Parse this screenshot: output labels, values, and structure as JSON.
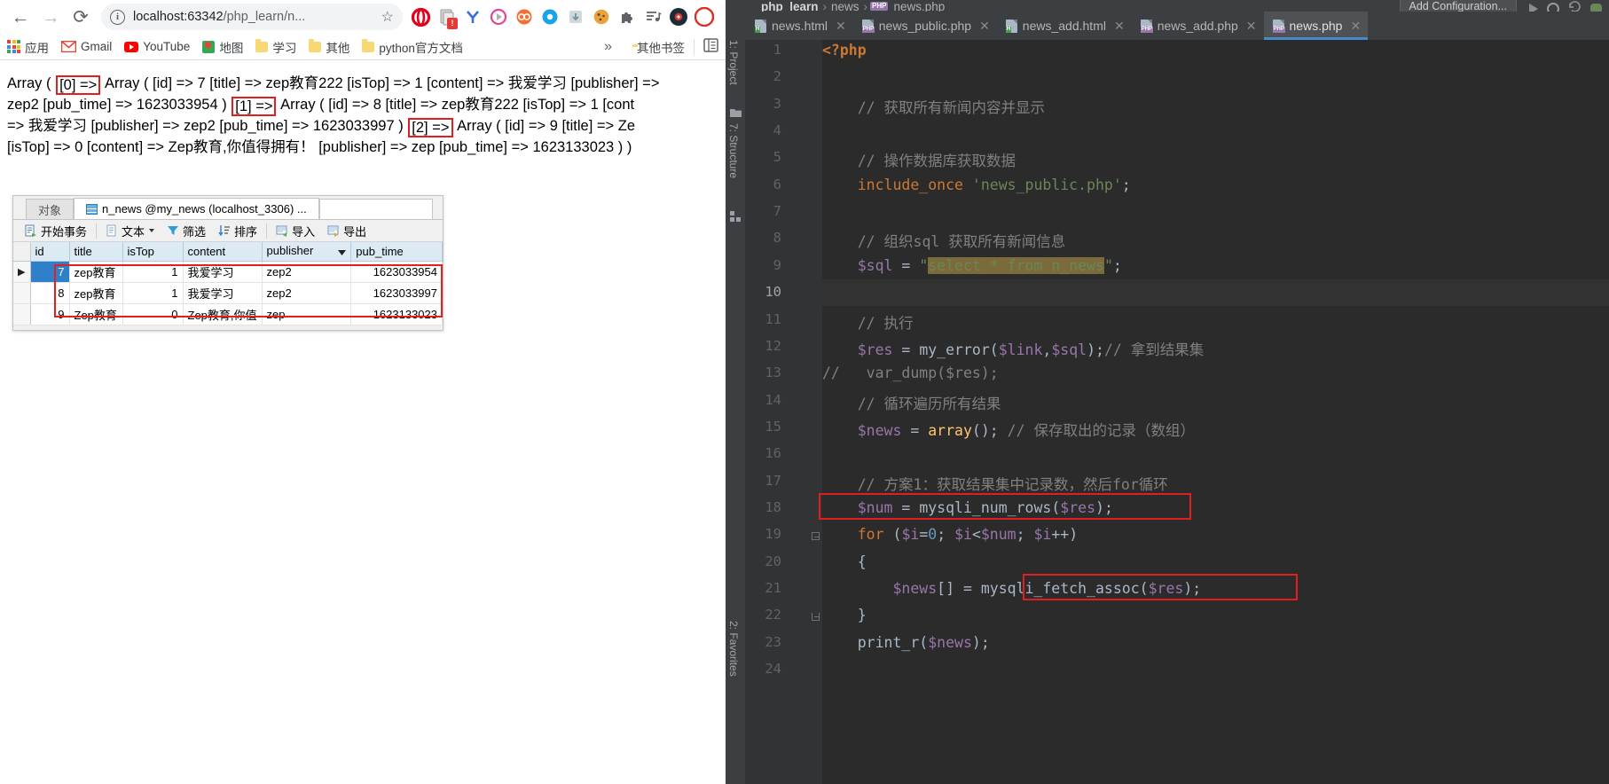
{
  "browser": {
    "nav": {
      "back": "←",
      "forward": "→",
      "reload": "⟳"
    },
    "omnibox": {
      "site_info_icon": "info-icon",
      "url_host": "localhost:63342",
      "url_path": "/php_learn/n...",
      "star_icon": "☆"
    },
    "bookmarks": [
      {
        "label": "应用",
        "icon": "apps-grid-icon"
      },
      {
        "label": "Gmail",
        "icon": "gmail-icon"
      },
      {
        "label": "YouTube",
        "icon": "youtube-icon"
      },
      {
        "label": "地图",
        "icon": "maps-icon"
      },
      {
        "label": "学习",
        "icon": "folder-icon"
      },
      {
        "label": "其他",
        "icon": "folder-icon"
      },
      {
        "label": "python官方文档",
        "icon": "folder-icon"
      }
    ],
    "bookmarks_overflow": "»",
    "bookmarks_right": {
      "label": "其他书签",
      "icon": "folder-icon",
      "reading_list_icon": "reading-list-icon"
    },
    "page_output": {
      "line1_a": "Array ( ",
      "line1_hl": "[0] =>",
      "line1_b": " Array ( [id] => 7 [title] => zep教育222 [isTop] => 1 [content] => 我爱学习 [publisher] =>",
      "line2_a": "zep2 [pub_time] => 1623033954 ) ",
      "line2_hl": "[1] =>",
      "line2_b": " Array ( [id] => 8 [title] => zep教育222 [isTop] => 1 [cont",
      "line3_a": "=> 我爱学习 [publisher] => zep2 [pub_time] => 1623033997 ) ",
      "line3_hl": "[2] =>",
      "line3_b": " Array ( [id] => 9 [title] => Ze",
      "line4": "[isTop] => 0 [content] => Zep教育,你值得拥有！ [publisher] => zep [pub_time] => 1623133023 ) )"
    }
  },
  "navicat": {
    "tabs": [
      {
        "label": "对象",
        "active": false
      },
      {
        "label": "n_news @my_news (localhost_3306) ...",
        "active": true
      }
    ],
    "toolbar": [
      {
        "label": "开始事务",
        "icon": "transaction-icon"
      },
      {
        "label": "文本",
        "icon": "text-icon",
        "caret": true
      },
      {
        "label": "筛选",
        "icon": "filter-icon"
      },
      {
        "label": "排序",
        "icon": "sort-icon"
      },
      {
        "label": "导入",
        "icon": "import-icon"
      },
      {
        "label": "导出",
        "icon": "export-icon"
      }
    ],
    "grid": {
      "columns": [
        "id",
        "title",
        "isTop",
        "content",
        "publisher",
        "pub_time"
      ],
      "sorted_column": "publisher",
      "rows": [
        {
          "marker": "▶",
          "id": "7",
          "title": "zep教育",
          "isTop": "1",
          "content": "我爱学习",
          "publisher": "zep2",
          "pub_time": "1623033954",
          "selected": true
        },
        {
          "marker": "",
          "id": "8",
          "title": "zep教育",
          "isTop": "1",
          "content": "我爱学习",
          "publisher": "zep2",
          "pub_time": "1623033997",
          "selected": false
        },
        {
          "marker": "",
          "id": "9",
          "title": "Zep教育",
          "isTop": "0",
          "content": "Zep教育,你值",
          "publisher": "zep",
          "pub_time": "1623133023",
          "selected": false
        }
      ]
    }
  },
  "ide": {
    "breadcrumb": {
      "project": "php_learn",
      "folder": "news",
      "file": "news.php",
      "sep": "›",
      "file_tag": "PHP"
    },
    "add_configuration": "Add Configuration...",
    "tabs": [
      {
        "label": "news.html",
        "type": "html",
        "active": false
      },
      {
        "label": "news_public.php",
        "type": "php",
        "active": false
      },
      {
        "label": "news_add.html",
        "type": "html",
        "active": false
      },
      {
        "label": "news_add.php",
        "type": "php",
        "active": false
      },
      {
        "label": "news.php",
        "type": "php",
        "active": true
      }
    ],
    "tab_close": "✕",
    "side_strips": [
      {
        "label": "1: Project"
      },
      {
        "label": "7: Structure"
      },
      {
        "label": "2: Favorites"
      }
    ],
    "line_numbers": [
      "1",
      "2",
      "3",
      "4",
      "5",
      "6",
      "7",
      "8",
      "9",
      "10",
      "11",
      "12",
      "13",
      "14",
      "15",
      "16",
      "17",
      "18",
      "19",
      "20",
      "21",
      "22",
      "23",
      "24"
    ],
    "current_line": "10",
    "code": [
      {
        "n": "1",
        "segs": [
          {
            "t": "<?php",
            "c": "kk"
          }
        ]
      },
      {
        "n": "2",
        "segs": []
      },
      {
        "n": "3",
        "segs": [
          {
            "t": "    // 获取所有新闻内容并显示",
            "c": "c"
          }
        ]
      },
      {
        "n": "4",
        "segs": []
      },
      {
        "n": "5",
        "segs": [
          {
            "t": "    // 操作数据库获取数据",
            "c": "c"
          }
        ]
      },
      {
        "n": "6",
        "segs": [
          {
            "t": "    ",
            "c": "p"
          },
          {
            "t": "include_once",
            "c": "k"
          },
          {
            "t": " ",
            "c": "p"
          },
          {
            "t": "'news_public.php'",
            "c": "s"
          },
          {
            "t": ";",
            "c": "p"
          }
        ]
      },
      {
        "n": "7",
        "segs": []
      },
      {
        "n": "8",
        "segs": [
          {
            "t": "    // 组织sql 获取所有新闻信息",
            "c": "c"
          }
        ]
      },
      {
        "n": "9",
        "segs": [
          {
            "t": "    ",
            "c": "p"
          },
          {
            "t": "$sql",
            "c": "v"
          },
          {
            "t": " = ",
            "c": "p"
          },
          {
            "t": "\"",
            "c": "s"
          },
          {
            "t": "select * from n_news",
            "c": "s hl-find"
          },
          {
            "t": "\"",
            "c": "s"
          },
          {
            "t": ";",
            "c": "p"
          }
        ]
      },
      {
        "n": "10",
        "segs": []
      },
      {
        "n": "11",
        "segs": [
          {
            "t": "    // 执行",
            "c": "c"
          }
        ]
      },
      {
        "n": "12",
        "segs": [
          {
            "t": "    ",
            "c": "p"
          },
          {
            "t": "$res",
            "c": "v"
          },
          {
            "t": " = ",
            "c": "p"
          },
          {
            "t": "my_error",
            "c": "p"
          },
          {
            "t": "(",
            "c": "p"
          },
          {
            "t": "$link",
            "c": "v"
          },
          {
            "t": ",",
            "c": "p"
          },
          {
            "t": "$sql",
            "c": "v"
          },
          {
            "t": ");",
            "c": "p"
          },
          {
            "t": "// 拿到结果集",
            "c": "c"
          }
        ]
      },
      {
        "n": "13",
        "segs": [
          {
            "t": "//   var_dump($res);",
            "c": "c"
          }
        ]
      },
      {
        "n": "14",
        "segs": [
          {
            "t": "    // 循环遍历所有结果",
            "c": "c"
          }
        ]
      },
      {
        "n": "15",
        "segs": [
          {
            "t": "    ",
            "c": "p"
          },
          {
            "t": "$news",
            "c": "v"
          },
          {
            "t": " = ",
            "c": "p"
          },
          {
            "t": "array",
            "c": "f"
          },
          {
            "t": "(); ",
            "c": "p"
          },
          {
            "t": "// 保存取出的记录（数组）",
            "c": "c"
          }
        ]
      },
      {
        "n": "16",
        "segs": []
      },
      {
        "n": "17",
        "segs": [
          {
            "t": "    // 方案1：获取结果集中记录数，然后for循环",
            "c": "c"
          }
        ]
      },
      {
        "n": "18",
        "segs": [
          {
            "t": "    ",
            "c": "p"
          },
          {
            "t": "$num",
            "c": "v"
          },
          {
            "t": " = ",
            "c": "p"
          },
          {
            "t": "mysqli_num_rows",
            "c": "p"
          },
          {
            "t": "(",
            "c": "p"
          },
          {
            "t": "$res",
            "c": "v"
          },
          {
            "t": ");",
            "c": "p"
          }
        ]
      },
      {
        "n": "19",
        "segs": [
          {
            "t": "    ",
            "c": "p"
          },
          {
            "t": "for",
            "c": "k"
          },
          {
            "t": " (",
            "c": "p"
          },
          {
            "t": "$i",
            "c": "v"
          },
          {
            "t": "=",
            "c": "p"
          },
          {
            "t": "0",
            "c": "n"
          },
          {
            "t": "; ",
            "c": "p"
          },
          {
            "t": "$i",
            "c": "v"
          },
          {
            "t": "<",
            "c": "p"
          },
          {
            "t": "$num",
            "c": "v"
          },
          {
            "t": "; ",
            "c": "p"
          },
          {
            "t": "$i",
            "c": "v"
          },
          {
            "t": "++)",
            "c": "p"
          }
        ]
      },
      {
        "n": "20",
        "segs": [
          {
            "t": "    {",
            "c": "p"
          }
        ]
      },
      {
        "n": "21",
        "segs": [
          {
            "t": "        ",
            "c": "p"
          },
          {
            "t": "$news",
            "c": "v"
          },
          {
            "t": "[] = ",
            "c": "p"
          },
          {
            "t": "mysqli_fetch_assoc",
            "c": "p"
          },
          {
            "t": "(",
            "c": "p"
          },
          {
            "t": "$res",
            "c": "v"
          },
          {
            "t": ");",
            "c": "p"
          }
        ]
      },
      {
        "n": "22",
        "segs": [
          {
            "t": "    }",
            "c": "p"
          }
        ]
      },
      {
        "n": "23",
        "segs": [
          {
            "t": "    ",
            "c": "p"
          },
          {
            "t": "print_r",
            "c": "p"
          },
          {
            "t": "(",
            "c": "p"
          },
          {
            "t": "$news",
            "c": "v"
          },
          {
            "t": ");",
            "c": "p"
          }
        ]
      },
      {
        "n": "24",
        "segs": []
      }
    ],
    "annotations": [
      {
        "name": "num-rows-highlight",
        "line": 18
      },
      {
        "name": "fetch-assoc-highlight",
        "line": 21
      }
    ]
  },
  "colors": {
    "accent_red": "#e02020",
    "ide_bg": "#3c3f41",
    "editor_bg": "#2b2b2b",
    "tab_active": "#4a88c7",
    "grid_header": "#dceaf4",
    "grid_selected": "#2f80c9"
  }
}
